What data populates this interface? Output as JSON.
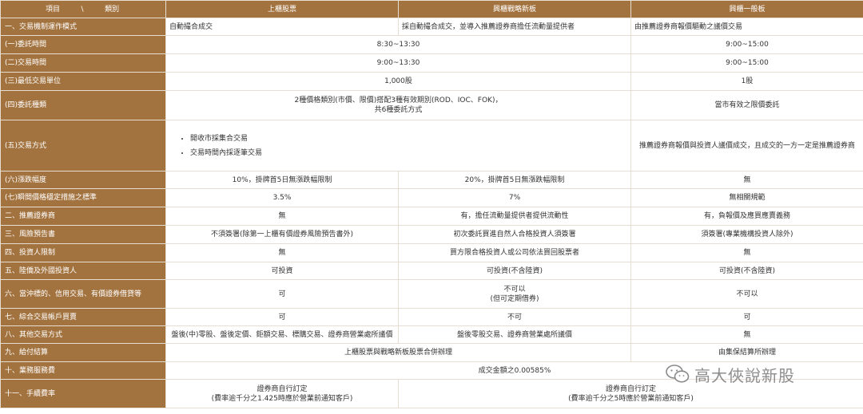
{
  "header": {
    "corner_left": "項目",
    "corner_sep": "\\",
    "corner_right": "類別",
    "col1": "上櫃股票",
    "col2": "興櫃戰略新板",
    "col3": "興櫃一般板"
  },
  "rows": {
    "r1": {
      "label": "一、交易機制運作模式",
      "c1": "自動撮合成交",
      "c2": "採自動撮合成交，並導入推薦證券商擔任流動量提供者",
      "c3": "由推薦證券商報價驅動之議價交易"
    },
    "r2": {
      "label": "(一)委託時間",
      "c12": "8:30~13:30",
      "c3": "9:00~15:00"
    },
    "r3": {
      "label": "(二)交易時間",
      "c12": "9:00~13:30",
      "c3": "9:00~15:00"
    },
    "r4": {
      "label": "(三)最低交易單位",
      "c12": "1,000股",
      "c3": "1股"
    },
    "r5": {
      "label": "(四)委託種類",
      "c12_l1": "2種價格類別(市價、限價)搭配3種有效期別(ROD、IOC、FOK)，",
      "c12_l2": "共6種委託方式",
      "c3": "當市有效之限價委託"
    },
    "r6": {
      "label": "(五)交易方式",
      "c12_b1": "開收市採集合交易",
      "c12_b2": "交易時間內採逐筆交易",
      "c3": "推薦證券商報價與投資人議價成交，且成交的一方一定是推薦證券商"
    },
    "r7": {
      "label": "(六)漲跌幅度",
      "c1": "10%，掛牌首5日無漲跌幅限制",
      "c2": "20%，掛牌首5日無漲跌幅限制",
      "c3": "無"
    },
    "r8": {
      "label": "(七)瞬間價格穩定措施之標準",
      "c1": "3.5%",
      "c2": "7%",
      "c3": "無相關規範"
    },
    "r9": {
      "label": "二、推薦證券商",
      "c1": "無",
      "c2": "有，擔任流動量提供者提供流動性",
      "c3": "有，負報價及應買應賣義務"
    },
    "r10": {
      "label": "三、風險預告書",
      "c1": "不須簽署(除第一上櫃有價證券風險預告書外)",
      "c2": "初次委託買進自然人合格投資人須簽署",
      "c3": "須簽署(專業機構投資人除外)"
    },
    "r11": {
      "label": "四、投資人限制",
      "c1": "無",
      "c2": "買方限合格投資人或公司依法買回股票者",
      "c3": "無"
    },
    "r12": {
      "label": "五、陸僑及外國投資人",
      "c1": "可投資",
      "c2": "可投資(不含陸資)",
      "c3": "可投資(不含陸資)"
    },
    "r13": {
      "label": "六、當沖標的、信用交易、有價證券借貸等",
      "c1": "可",
      "c2_l1": "不可以",
      "c2_l2": "(但可定期借券)",
      "c3": "不可以"
    },
    "r14": {
      "label": "七、綜合交易帳戶買賣",
      "c1": "可",
      "c2": "不可",
      "c3": "可"
    },
    "r15": {
      "label": "八、其他交易方式",
      "c1": "盤後(中)零股、盤後定價、鉅額交易、標購交易、證券商營業處所議價",
      "c2": "盤後零股交易、證券商營業處所議價",
      "c3": "無"
    },
    "r16": {
      "label": "九、給付結算",
      "c12": "上櫃股票與戰略新板股票合併辦理",
      "c3": "由集保結算所辦理"
    },
    "r17": {
      "label": "十、業務服務費",
      "c123": "成交金額之0.00585%"
    },
    "r18": {
      "label": "十一、手續費率",
      "c1_l1": "證券商自行訂定",
      "c1_l2": "(費率逾千分之1.425時應於營業前通知客戶)",
      "c23_l1": "證券商自行訂定",
      "c23_l2": "(費率逾千分之5時應於營業前通知客戶)"
    }
  },
  "watermark": {
    "text": "高大俠說新股"
  },
  "colors": {
    "header_bg": "#a3733f",
    "border": "#e7ddd2"
  }
}
